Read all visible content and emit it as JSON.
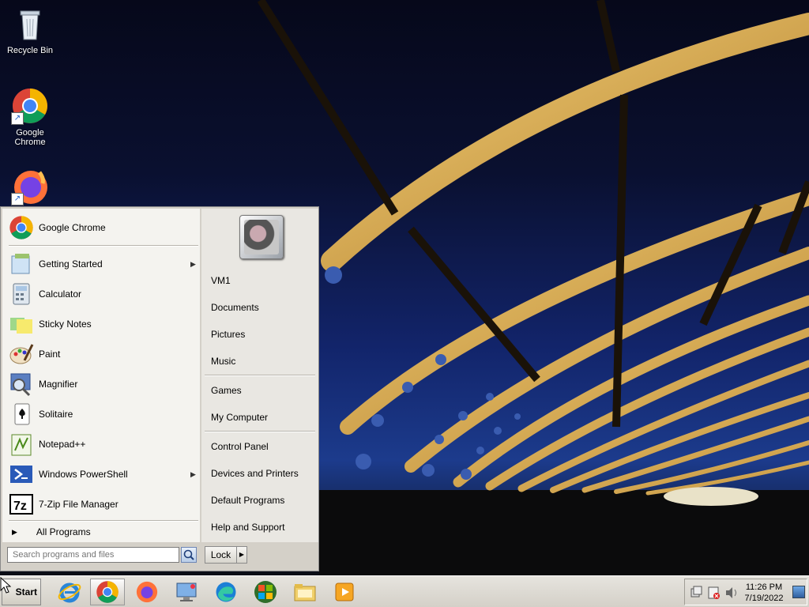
{
  "desktop": {
    "icons": [
      {
        "label": "Recycle Bin",
        "icon": "recycle-bin-icon"
      },
      {
        "label": "Google Chrome",
        "icon": "chrome-icon"
      },
      {
        "label": "",
        "icon": "firefox-icon"
      }
    ]
  },
  "start_menu": {
    "pinned": {
      "label": "Google Chrome",
      "icon": "chrome-icon"
    },
    "programs": [
      {
        "label": "Getting Started",
        "icon": "getting-started-icon",
        "submenu": true
      },
      {
        "label": "Calculator",
        "icon": "calculator-icon",
        "submenu": false
      },
      {
        "label": "Sticky Notes",
        "icon": "sticky-notes-icon",
        "submenu": false
      },
      {
        "label": "Paint",
        "icon": "paint-icon",
        "submenu": false
      },
      {
        "label": "Magnifier",
        "icon": "magnifier-icon",
        "submenu": false
      },
      {
        "label": "Solitaire",
        "icon": "solitaire-icon",
        "submenu": false
      },
      {
        "label": "Notepad++",
        "icon": "notepadpp-icon",
        "submenu": false
      },
      {
        "label": "Windows PowerShell",
        "icon": "powershell-icon",
        "submenu": true
      },
      {
        "label": "7-Zip File Manager",
        "icon": "7zip-icon",
        "submenu": false
      }
    ],
    "all_programs": "All Programs",
    "search_placeholder": "Search programs and files",
    "right": {
      "user": "VM1",
      "documents": "Documents",
      "pictures": "Pictures",
      "music": "Music",
      "games": "Games",
      "my_computer": "My Computer",
      "control_panel": "Control Panel",
      "devices_printers": "Devices and Printers",
      "default_programs": "Default Programs",
      "help_support": "Help and Support"
    },
    "lock_label": "Lock"
  },
  "taskbar": {
    "start_label": "Start",
    "apps": [
      {
        "name": "internet-explorer",
        "icon": "ie-icon",
        "active": false
      },
      {
        "name": "google-chrome",
        "icon": "chrome-icon",
        "active": true
      },
      {
        "name": "firefox",
        "icon": "firefox-icon",
        "active": false
      },
      {
        "name": "remote-desktop",
        "icon": "monitor-icon",
        "active": false
      },
      {
        "name": "microsoft-edge",
        "icon": "edge-icon",
        "active": false
      },
      {
        "name": "windows",
        "icon": "windows-logo-icon",
        "active": false
      },
      {
        "name": "file-explorer",
        "icon": "folder-icon",
        "active": false
      },
      {
        "name": "media-player",
        "icon": "media-player-icon",
        "active": false
      }
    ],
    "clock_time": "11:26 PM",
    "clock_date": "7/19/2022"
  }
}
